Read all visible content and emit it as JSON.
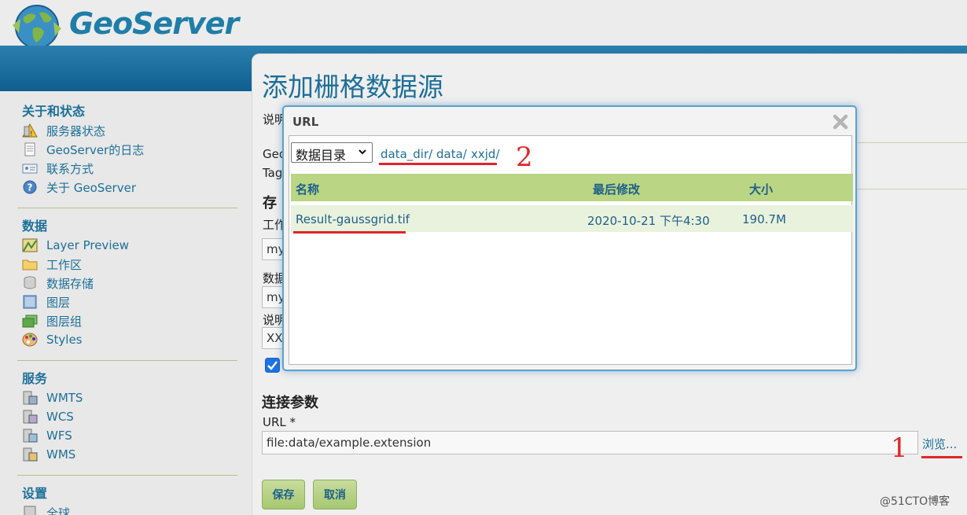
{
  "app": {
    "logo_text": "GeoServer"
  },
  "sidebar": {
    "sections": [
      {
        "title": "关于和状态",
        "items": [
          {
            "label": "服务器状态",
            "icon": "server-status-icon"
          },
          {
            "label": "GeoServer的日志",
            "icon": "log-document-icon"
          },
          {
            "label": "联系方式",
            "icon": "contact-card-icon"
          },
          {
            "label": "关于 GeoServer",
            "icon": "help-circle-icon"
          }
        ]
      },
      {
        "title": "数据",
        "items": [
          {
            "label": "Layer Preview",
            "icon": "layer-preview-icon"
          },
          {
            "label": "工作区",
            "icon": "folder-icon"
          },
          {
            "label": "数据存储",
            "icon": "database-icon"
          },
          {
            "label": "图层",
            "icon": "layer-icon"
          },
          {
            "label": "图层组",
            "icon": "layer-group-icon"
          },
          {
            "label": "Styles",
            "icon": "palette-icon"
          }
        ]
      },
      {
        "title": "服务",
        "items": [
          {
            "label": "WMTS",
            "icon": "wmts-service-icon"
          },
          {
            "label": "WCS",
            "icon": "wcs-service-icon"
          },
          {
            "label": "WFS",
            "icon": "wfs-service-icon"
          },
          {
            "label": "WMS",
            "icon": "wms-service-icon"
          }
        ]
      },
      {
        "title": "设置",
        "items": [
          {
            "label": "全球",
            "icon": "globe-settings-icon"
          }
        ]
      }
    ]
  },
  "content": {
    "page_title": "添加栅格数据源",
    "fragments": {
      "description": "说明",
      "geo": "Geo",
      "tag": "Tag",
      "store_heading": "存",
      "work": "工作",
      "my1": "my",
      "data": "数据",
      "my2": "my",
      "desc2": "说明",
      "xx": "XX"
    },
    "connection_heading": "连接参数",
    "url_label": "URL *",
    "url_value": "file:data/example.extension",
    "browse_label": "浏览...",
    "save_label": "保存",
    "cancel_label": "取消"
  },
  "dialog": {
    "title": "URL",
    "directory_select": "数据目录",
    "breadcrumb": [
      "data_dir/",
      "data/",
      "xxjd/"
    ],
    "columns": {
      "name": "名称",
      "modified": "最后修改",
      "size": "大小"
    },
    "files": [
      {
        "name": "Result-gaussgrid.tif",
        "modified": "2020-10-21 下午4:30",
        "size": "190.7M"
      }
    ]
  },
  "annotations": {
    "step1": "1",
    "step2": "2",
    "accent_color": "#e0262a"
  },
  "watermark": "@51CTO博客"
}
